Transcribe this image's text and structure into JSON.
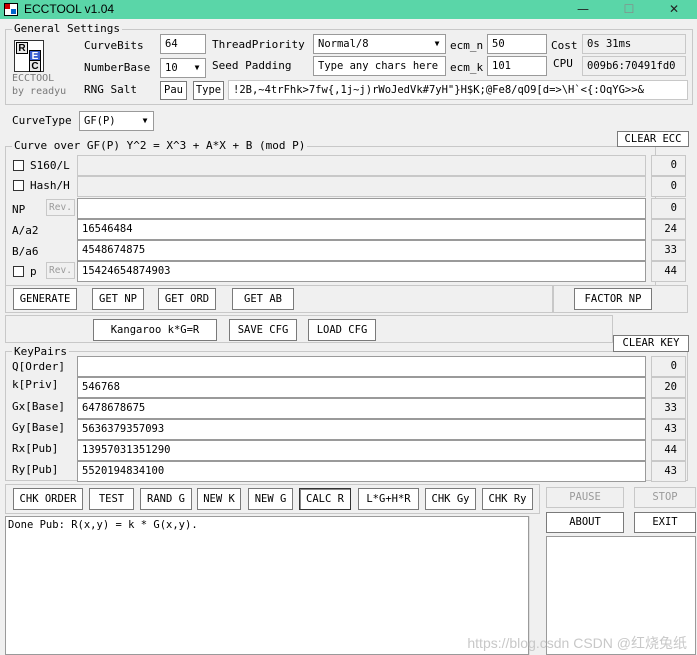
{
  "window": {
    "title": "ECCTOOL v1.04"
  },
  "logo": {
    "line1": "ECCTOOL",
    "line2": "by readyu",
    "letters": [
      "R",
      "E",
      "C"
    ]
  },
  "general": {
    "legend": "General Settings",
    "curve_bits_label": "CurveBits",
    "curve_bits": "64",
    "number_base_label": "NumberBase",
    "number_base": "10",
    "rng_salt_label": "RNG Salt",
    "pau_btn": "Pau",
    "type_btn": "Type",
    "thread_priority_label": "ThreadPriority",
    "thread_priority": "Normal/8",
    "seed_padding_label": "Seed Padding",
    "seed_padding": "Type any chars here",
    "ecm_n_label": "ecm_n",
    "ecm_n": "50",
    "ecm_k_label": "ecm_k",
    "ecm_k": "101",
    "cost_label": "Cost",
    "cost": "0s 31ms",
    "cpu_label": "CPU",
    "cpu": "009b6:70491fd0",
    "salt_value": "!2B,~4trFhk>7fw{,1j~j)rWoJedVk#7yH\"}H$K;@Fe8/qO9[d=>\\H`<{:OqYG>>&"
  },
  "curve_type": {
    "label": "CurveType",
    "value": "GF(P)"
  },
  "curve": {
    "legend": "Curve over GF(P) Y^2 = X^3 + A*X + B (mod P)",
    "clear_btn": "CLEAR ECC",
    "rows": [
      {
        "label": "S160/L",
        "value": "",
        "count": "0"
      },
      {
        "label": "Hash/H",
        "value": "",
        "count": "0"
      },
      {
        "label": "NP",
        "value": "",
        "count": "0",
        "rev": "Rev."
      },
      {
        "label": "A/a2",
        "value": "16546484",
        "count": "24"
      },
      {
        "label": "B/a6",
        "value": "4548674875",
        "count": "33"
      },
      {
        "label": "p",
        "value": "15424654874903",
        "count": "44",
        "rev": "Rev."
      }
    ]
  },
  "curve_actions": {
    "generate": "GENERATE",
    "get_np": "GET NP",
    "get_ord": "GET ORD",
    "get_ab": "GET AB",
    "factor_np": "FACTOR NP",
    "kangaroo": "Kangaroo k*G=R",
    "save_cfg": "SAVE CFG",
    "load_cfg": "LOAD CFG"
  },
  "keypairs": {
    "legend": "KeyPairs",
    "clear_btn": "CLEAR KEY",
    "rows": [
      {
        "label": "Q[Order]",
        "value": "",
        "count": "0"
      },
      {
        "label": "k[Priv]",
        "value": "546768",
        "count": "20"
      },
      {
        "label": "Gx[Base]",
        "value": "6478678675",
        "count": "33"
      },
      {
        "label": "Gy[Base]",
        "value": "5636379357093",
        "count": "43"
      },
      {
        "label": "Rx[Pub]",
        "value": "13957031351290",
        "count": "44"
      },
      {
        "label": "Ry[Pub]",
        "value": "5520194834100",
        "count": "43"
      }
    ]
  },
  "key_actions": {
    "chk_order": "CHK ORDER",
    "test": "TEST",
    "rand_g": "RAND G",
    "new_k": "NEW K",
    "new_g": "NEW G",
    "calc_r": "CALC R",
    "lgh": "L*G+H*R",
    "chk_gy": "CHK Gy",
    "chk_ry": "CHK Ry",
    "pause": "PAUSE",
    "stop": "STOP",
    "about": "ABOUT",
    "exit": "EXIT"
  },
  "log": {
    "text": "Done Pub: R(x,y) = k * G(x,y)."
  },
  "watermark": "https://blog.csdn CSDN @红烧兔纸"
}
